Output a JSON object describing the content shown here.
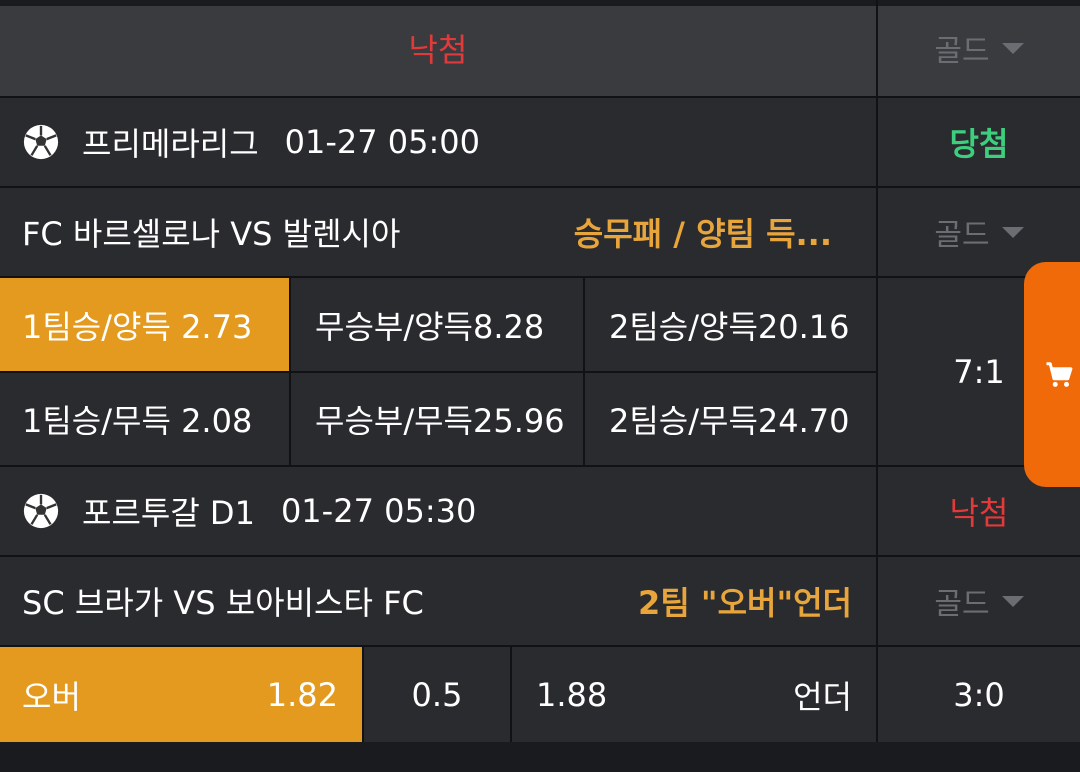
{
  "header": {
    "status": "낙첨",
    "gold_label": "골드"
  },
  "matches": [
    {
      "league": "프리메라리그",
      "datetime": "01-27 05:00",
      "result": "당첨",
      "teams": "FC 바르셀로나 VS 발렌시아",
      "bet_type": "승무패 / 양팀 득...",
      "gold_label": "골드",
      "score": "7:1",
      "odds": [
        [
          {
            "label": "1팀승/양득 2.73",
            "selected": true
          },
          {
            "label": "무승부/양득8.28"
          },
          {
            "label": "2팀승/양득20.16"
          }
        ],
        [
          {
            "label": "1팀승/무득 2.08"
          },
          {
            "label": "무승부/무득25.96"
          },
          {
            "label": "2팀승/무득24.70"
          }
        ]
      ]
    },
    {
      "league": "포르투갈 D1",
      "datetime": "01-27 05:30",
      "result": "낙첨",
      "teams": "SC 브라가 VS 보아비스타 FC",
      "bet_type": "2팀 \"오버\"언더",
      "gold_label": "골드",
      "score": "3:0",
      "ou": {
        "over_label": "오버",
        "over_odds": "1.82",
        "line": "0.5",
        "under_odds": "1.88",
        "under_label": "언더"
      }
    }
  ],
  "icons": {
    "ball": "soccer-ball-icon",
    "cart": "cart-icon",
    "dropdown": "chevron-down-icon"
  },
  "colors": {
    "lose": "#e23a3a",
    "win": "#3ccf7d",
    "bet_type": "#e8a53b",
    "selected": "#e39a1e",
    "cart_tab": "#f06a0a"
  }
}
